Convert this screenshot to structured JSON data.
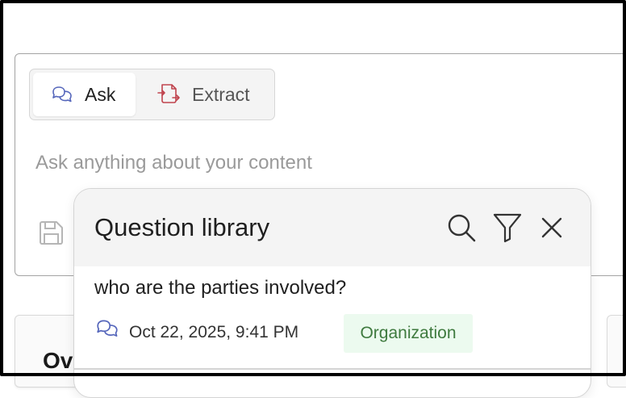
{
  "composer": {
    "modes": [
      {
        "label": "Ask",
        "icon": "chat-bubbles-icon",
        "active": true
      },
      {
        "label": "Extract",
        "icon": "extract-icon",
        "active": false
      }
    ],
    "input": {
      "placeholder": "Ask anything about your content",
      "value": ""
    },
    "save_icon": "save-icon"
  },
  "question_library": {
    "title": "Question library",
    "actions": [
      "search-icon",
      "filter-icon",
      "close-icon"
    ],
    "items": [
      {
        "question": "who are the parties involved?",
        "type_icon": "chat-bubbles-icon",
        "date": "Oct 22, 2025, 9:41 PM",
        "scope": "Organization"
      }
    ]
  },
  "background_card": {
    "title": "Ov"
  },
  "colors": {
    "ask_icon": "#5566bb",
    "extract_icon": "#c0444e",
    "badge_bg": "#ecfaef",
    "badge_text": "#3f7a3f"
  }
}
